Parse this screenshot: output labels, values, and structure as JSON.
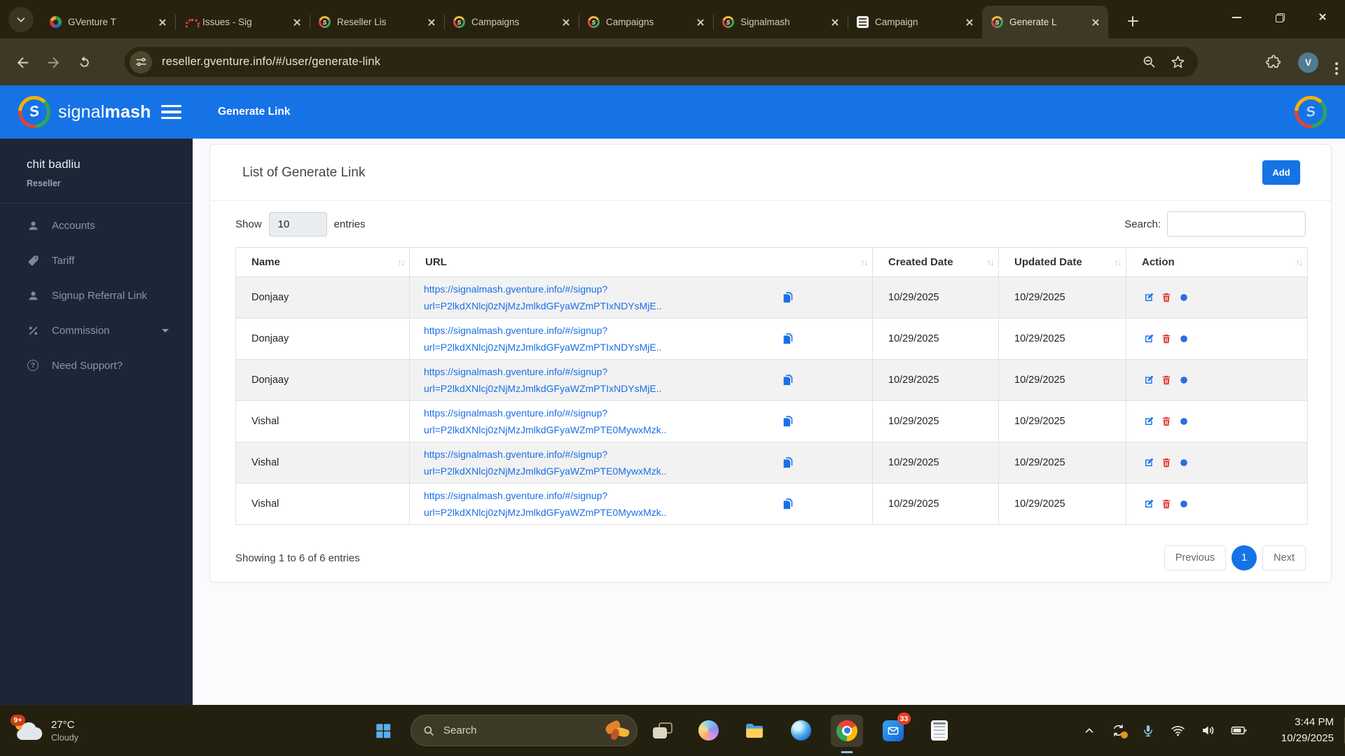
{
  "browser": {
    "tabs": [
      {
        "title": "GVenture T",
        "icon": "gventure-favicon",
        "active": false
      },
      {
        "title": "Issues - Sig",
        "icon": "issues-favicon",
        "active": false
      },
      {
        "title": "Reseller Lis",
        "icon": "signalmash-favicon",
        "active": false
      },
      {
        "title": "Campaigns",
        "icon": "signalmash-favicon",
        "active": false
      },
      {
        "title": "Campaigns",
        "icon": "signalmash-favicon",
        "active": false
      },
      {
        "title": "Signalmash",
        "icon": "signalmash-favicon",
        "active": false
      },
      {
        "title": "Campaign",
        "icon": "list-favicon",
        "active": false
      },
      {
        "title": "Generate L",
        "icon": "signalmash-favicon",
        "active": true
      }
    ],
    "url": "reseller.gventure.info/#/user/generate-link",
    "avatar_initial": "V"
  },
  "sidebar": {
    "brand_light": "signal",
    "brand_bold": "mash",
    "user_name": "chit badliu",
    "user_role": "Reseller",
    "items": [
      {
        "label": "Accounts",
        "icon": "person-icon"
      },
      {
        "label": "Tariff",
        "icon": "ticket-icon"
      },
      {
        "label": "Signup Referral Link",
        "icon": "person-icon"
      },
      {
        "label": "Commission",
        "icon": "percent-icon",
        "caret": true
      },
      {
        "label": "Need Support?",
        "icon": "question-icon"
      }
    ]
  },
  "topbar": {
    "title": "Generate Link"
  },
  "content": {
    "card_title": "List of Generate Link",
    "add_label": "Add",
    "show_label": "Show",
    "entries_label": "entries",
    "page_size": "10",
    "search_label": "Search:",
    "search_value": "",
    "table": {
      "headers": [
        "Name",
        "URL",
        "Created Date",
        "Updated Date",
        "Action"
      ],
      "rows": [
        {
          "name": "Donjaay",
          "url_line1": "https://signalmash.gventure.info/#/signup?",
          "url_line2": "url=P2lkdXNlcj0zNjMzJmlkdGFyaWZmPTIxNDYsMjE..",
          "created": "10/29/2025",
          "updated": "10/29/2025"
        },
        {
          "name": "Donjaay",
          "url_line1": "https://signalmash.gventure.info/#/signup?",
          "url_line2": "url=P2lkdXNlcj0zNjMzJmlkdGFyaWZmPTIxNDYsMjE..",
          "created": "10/29/2025",
          "updated": "10/29/2025"
        },
        {
          "name": "Donjaay",
          "url_line1": "https://signalmash.gventure.info/#/signup?",
          "url_line2": "url=P2lkdXNlcj0zNjMzJmlkdGFyaWZmPTIxNDYsMjE..",
          "created": "10/29/2025",
          "updated": "10/29/2025"
        },
        {
          "name": "Vishal",
          "url_line1": "https://signalmash.gventure.info/#/signup?",
          "url_line2": "url=P2lkdXNlcj0zNjMzJmlkdGFyaWZmPTE0MywxMzk..",
          "created": "10/29/2025",
          "updated": "10/29/2025"
        },
        {
          "name": "Vishal",
          "url_line1": "https://signalmash.gventure.info/#/signup?",
          "url_line2": "url=P2lkdXNlcj0zNjMzJmlkdGFyaWZmPTE0MywxMzk..",
          "created": "10/29/2025",
          "updated": "10/29/2025"
        },
        {
          "name": "Vishal",
          "url_line1": "https://signalmash.gventure.info/#/signup?",
          "url_line2": "url=P2lkdXNlcj0zNjMzJmlkdGFyaWZmPTE0MywxMzk..",
          "created": "10/29/2025",
          "updated": "10/29/2025"
        }
      ]
    },
    "footer_info": "Showing 1 to 6 of 6 entries",
    "pagination": {
      "previous": "Previous",
      "current_page": "1",
      "next": "Next"
    }
  },
  "taskbar": {
    "weather": {
      "badge": "9+",
      "temp": "27°C",
      "condition": "Cloudy"
    },
    "search_placeholder": "Search",
    "mail_badge": "33",
    "clock": {
      "time": "3:44 PM",
      "date": "10/29/2025"
    }
  },
  "colors": {
    "accent_blue": "#1673e6",
    "sidebar_bg": "#1d2637",
    "link_blue": "#1a6fe8",
    "danger_red": "#e3342f",
    "row_stripe": "#f2f2f2",
    "browser_chrome": "#3e3826"
  }
}
